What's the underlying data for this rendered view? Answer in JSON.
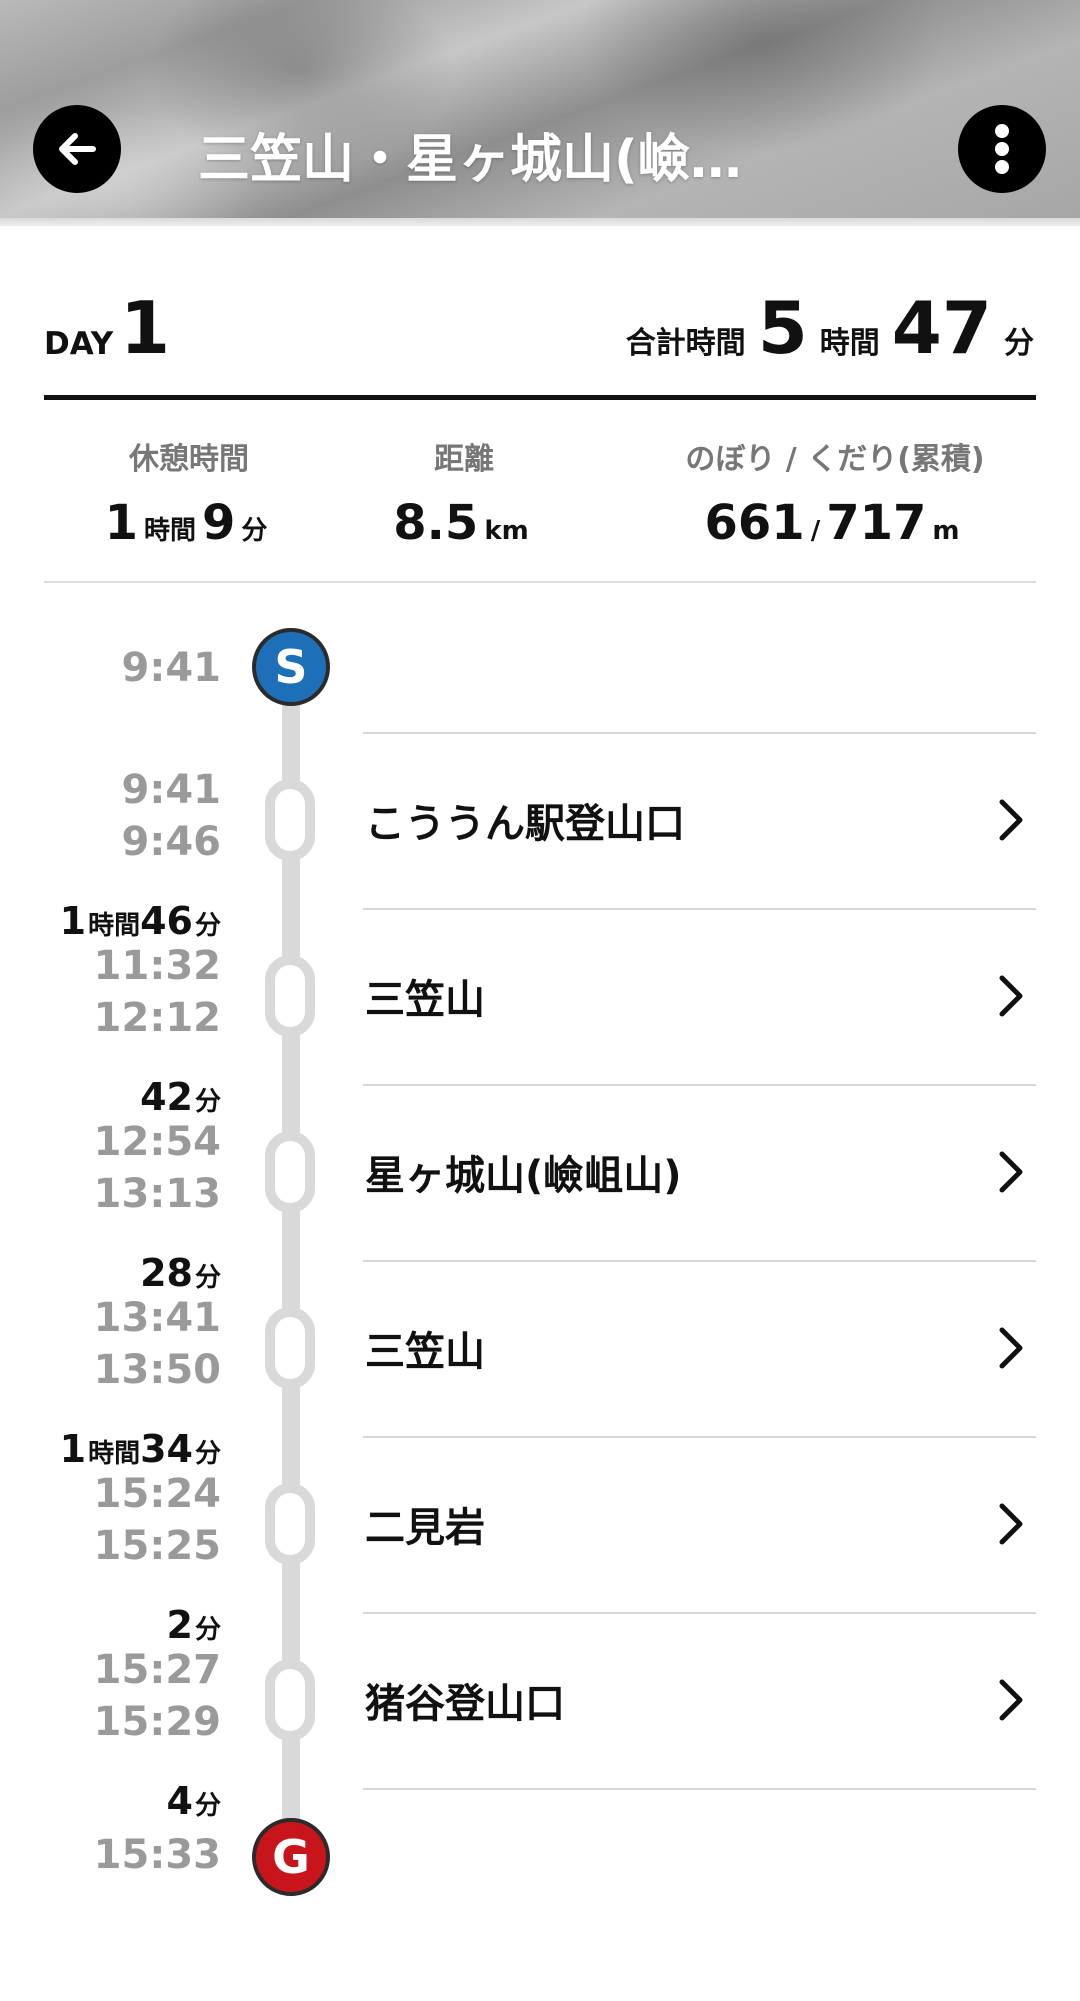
{
  "header": {
    "title": "三笠山・星ヶ城山(嶮…",
    "back_icon": "arrow-left-icon",
    "menu_icon": "more-vertical-icon"
  },
  "summary": {
    "day_label": "DAY",
    "day_number": "1",
    "total_label": "合計時間",
    "total_hours": "5",
    "hours_unit": "時間",
    "total_minutes": "47",
    "minutes_unit": "分"
  },
  "stats": {
    "rest": {
      "label": "休憩時間",
      "hours": "1",
      "hours_unit": "時間",
      "minutes": "9",
      "minutes_unit": "分"
    },
    "distance": {
      "label": "距離",
      "value": "8.5",
      "unit": "km"
    },
    "elevation": {
      "label": "のぼり / くだり(累積)",
      "up": "661",
      "separator": "/",
      "down": "717",
      "unit": "m"
    }
  },
  "timeline": {
    "start": {
      "badge": "S",
      "time": "9:41"
    },
    "goal": {
      "badge": "G",
      "time": "15:33"
    },
    "stops": [
      {
        "name": "こううん駅登山口",
        "arrive": "9:41",
        "depart": "9:46"
      },
      {
        "name": "三笠山",
        "arrive": "11:32",
        "depart": "12:12"
      },
      {
        "name": "星ヶ城山(嶮岨山)",
        "arrive": "12:54",
        "depart": "13:13"
      },
      {
        "name": "三笠山",
        "arrive": "13:41",
        "depart": "13:50"
      },
      {
        "name": "二見岩",
        "arrive": "15:24",
        "depart": "15:25"
      },
      {
        "name": "猪谷登山口",
        "arrive": "15:27",
        "depart": "15:29"
      }
    ],
    "durations": [
      {
        "hours": "1",
        "hours_unit": "時間",
        "minutes": "46",
        "minutes_unit": "分"
      },
      {
        "minutes": "42",
        "minutes_unit": "分"
      },
      {
        "minutes": "28",
        "minutes_unit": "分"
      },
      {
        "hours": "1",
        "hours_unit": "時間",
        "minutes": "34",
        "minutes_unit": "分"
      },
      {
        "minutes": "2",
        "minutes_unit": "分"
      },
      {
        "minutes": "4",
        "minutes_unit": "分"
      }
    ]
  },
  "colors": {
    "start_marker": "#1d6fb8",
    "goal_marker": "#c8151c",
    "track": "#d9d9d9",
    "muted_text": "#9a9a9a"
  }
}
